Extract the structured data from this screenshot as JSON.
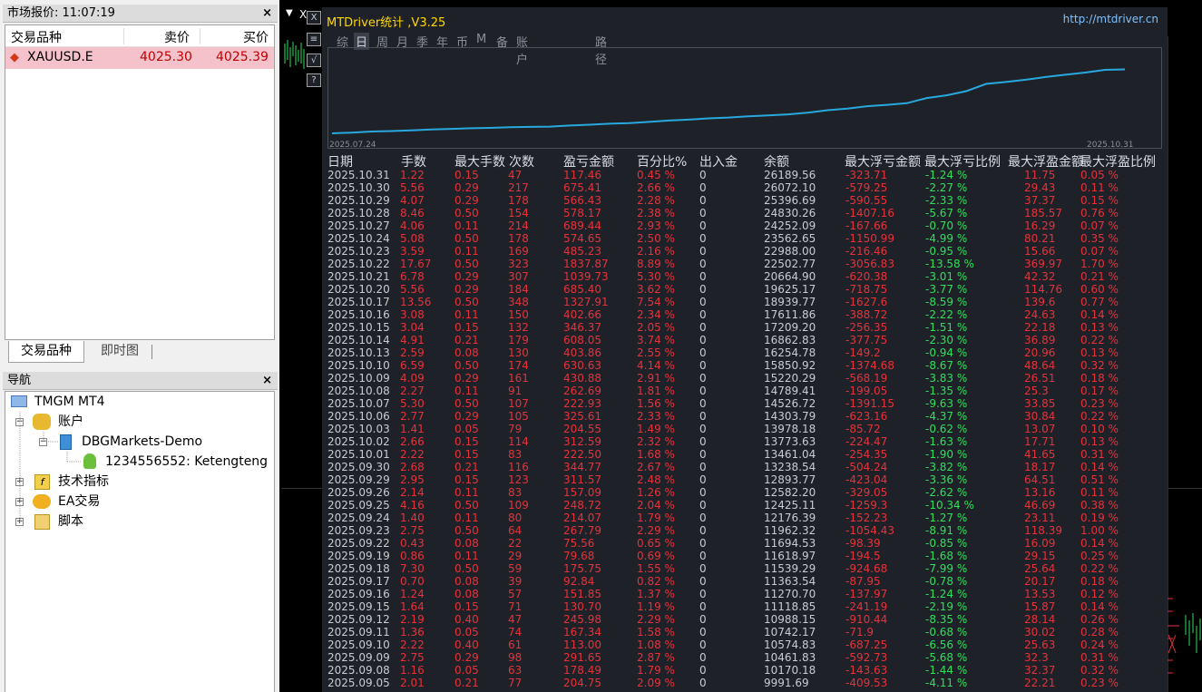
{
  "market_watch": {
    "title": "市场报价: 11:07:19",
    "columns": [
      "交易品种",
      "卖价",
      "买价"
    ],
    "row": {
      "symbol": "XAUUSD.E",
      "bid": "4025.30",
      "ask": "4025.39"
    },
    "tabs": [
      "交易品种",
      "即时图"
    ]
  },
  "navigator": {
    "title": "导航",
    "root": "TMGM MT4",
    "accounts": "账户",
    "server": "DBGMarkets-Demo",
    "account": "1234556552: Ketengteng",
    "indicators": "技术指标",
    "ea": "EA交易",
    "scripts": "脚本"
  },
  "chart_window": {
    "close_label": "X"
  },
  "overlay": {
    "title": "MTDriver统计 ,V3.25",
    "link": "http://mtdriver.cn",
    "tabs": [
      "综",
      "日",
      "周",
      "月",
      "季",
      "年",
      "币",
      "M",
      "备",
      "账户",
      "路径"
    ],
    "selected_tab": "日",
    "buttons": [
      "X",
      "≡",
      "√",
      "?"
    ],
    "headers": [
      "日期",
      "手数",
      "最大手数",
      "次数",
      "盈亏金额",
      "百分比%",
      "出入金",
      "余额",
      "最大浮亏金额",
      "最大浮亏比例",
      "最大浮盈金额",
      "最大浮盈比例"
    ]
  },
  "chart_data": {
    "type": "line",
    "x_start": "2025.07.24",
    "x_end": "2025.10.31",
    "line_color": "#29a8e0",
    "balance_series": [
      9991.69,
      10170.18,
      10461.83,
      10574.83,
      10742.17,
      10988.15,
      11118.85,
      11270.7,
      11363.54,
      11539.29,
      11618.97,
      11694.53,
      11962.32,
      12176.39,
      12425.11,
      12582.2,
      12893.77,
      13238.54,
      13461.04,
      13773.63,
      13978.18,
      14303.79,
      14526.72,
      14789.41,
      15220.29,
      15850.92,
      16254.78,
      16862.83,
      17209.2,
      17611.86,
      18939.77,
      19625.17,
      20664.9,
      22502.77,
      22988.0,
      23562.65,
      24252.09,
      24830.26,
      25396.69,
      26072.1,
      26189.56
    ],
    "rows": [
      [
        "2025.10.31",
        "1.22",
        "0.15",
        "47",
        "117.46",
        "0.45 %",
        "0",
        "26189.56",
        "-323.71",
        "-1.24 %",
        "11.75",
        "0.05 %"
      ],
      [
        "2025.10.30",
        "5.56",
        "0.29",
        "217",
        "675.41",
        "2.66 %",
        "0",
        "26072.10",
        "-579.25",
        "-2.27 %",
        "29.43",
        "0.11 %"
      ],
      [
        "2025.10.29",
        "4.07",
        "0.29",
        "178",
        "566.43",
        "2.28 %",
        "0",
        "25396.69",
        "-590.55",
        "-2.33 %",
        "37.37",
        "0.15 %"
      ],
      [
        "2025.10.28",
        "8.46",
        "0.50",
        "154",
        "578.17",
        "2.38 %",
        "0",
        "24830.26",
        "-1407.16",
        "-5.67 %",
        "185.57",
        "0.76 %"
      ],
      [
        "2025.10.27",
        "4.06",
        "0.11",
        "214",
        "689.44",
        "2.93 %",
        "0",
        "24252.09",
        "-167.66",
        "-0.70 %",
        "16.29",
        "0.07 %"
      ],
      [
        "2025.10.24",
        "5.08",
        "0.50",
        "178",
        "574.65",
        "2.50 %",
        "0",
        "23562.65",
        "-1150.99",
        "-4.99 %",
        "80.21",
        "0.35 %"
      ],
      [
        "2025.10.23",
        "3.59",
        "0.11",
        "169",
        "485.23",
        "2.16 %",
        "0",
        "22988.00",
        "-216.46",
        "-0.95 %",
        "15.66",
        "0.07 %"
      ],
      [
        "2025.10.22",
        "17.67",
        "0.50",
        "323",
        "1837.87",
        "8.89 %",
        "0",
        "22502.77",
        "-3056.83",
        "-13.58 %",
        "369.97",
        "1.70 %"
      ],
      [
        "2025.10.21",
        "6.78",
        "0.29",
        "307",
        "1039.73",
        "5.30 %",
        "0",
        "20664.90",
        "-620.38",
        "-3.01 %",
        "42.32",
        "0.21 %"
      ],
      [
        "2025.10.20",
        "5.56",
        "0.29",
        "184",
        "685.40",
        "3.62 %",
        "0",
        "19625.17",
        "-718.75",
        "-3.77 %",
        "114.76",
        "0.60 %"
      ],
      [
        "2025.10.17",
        "13.56",
        "0.50",
        "348",
        "1327.91",
        "7.54 %",
        "0",
        "18939.77",
        "-1627.6",
        "-8.59 %",
        "139.6",
        "0.77 %"
      ],
      [
        "2025.10.16",
        "3.08",
        "0.11",
        "150",
        "402.66",
        "2.34 %",
        "0",
        "17611.86",
        "-388.72",
        "-2.22 %",
        "24.63",
        "0.14 %"
      ],
      [
        "2025.10.15",
        "3.04",
        "0.15",
        "132",
        "346.37",
        "2.05 %",
        "0",
        "17209.20",
        "-256.35",
        "-1.51 %",
        "22.18",
        "0.13 %"
      ],
      [
        "2025.10.14",
        "4.91",
        "0.21",
        "179",
        "608.05",
        "3.74 %",
        "0",
        "16862.83",
        "-377.75",
        "-2.30 %",
        "36.89",
        "0.22 %"
      ],
      [
        "2025.10.13",
        "2.59",
        "0.08",
        "130",
        "403.86",
        "2.55 %",
        "0",
        "16254.78",
        "-149.2",
        "-0.94 %",
        "20.96",
        "0.13 %"
      ],
      [
        "2025.10.10",
        "6.59",
        "0.50",
        "174",
        "630.63",
        "4.14 %",
        "0",
        "15850.92",
        "-1374.68",
        "-8.67 %",
        "48.64",
        "0.32 %"
      ],
      [
        "2025.10.09",
        "4.09",
        "0.29",
        "161",
        "430.88",
        "2.91 %",
        "0",
        "15220.29",
        "-568.19",
        "-3.83 %",
        "26.51",
        "0.18 %"
      ],
      [
        "2025.10.08",
        "2.27",
        "0.11",
        "91",
        "262.69",
        "1.81 %",
        "0",
        "14789.41",
        "-199.05",
        "-1.35 %",
        "25.3",
        "0.17 %"
      ],
      [
        "2025.10.07",
        "5.30",
        "0.50",
        "107",
        "222.93",
        "1.56 %",
        "0",
        "14526.72",
        "-1391.15",
        "-9.63 %",
        "33.85",
        "0.23 %"
      ],
      [
        "2025.10.06",
        "2.77",
        "0.29",
        "105",
        "325.61",
        "2.33 %",
        "0",
        "14303.79",
        "-623.16",
        "-4.37 %",
        "30.84",
        "0.22 %"
      ],
      [
        "2025.10.03",
        "1.41",
        "0.05",
        "79",
        "204.55",
        "1.49 %",
        "0",
        "13978.18",
        "-85.72",
        "-0.62 %",
        "13.07",
        "0.10 %"
      ],
      [
        "2025.10.02",
        "2.66",
        "0.15",
        "114",
        "312.59",
        "2.32 %",
        "0",
        "13773.63",
        "-224.47",
        "-1.63 %",
        "17.71",
        "0.13 %"
      ],
      [
        "2025.10.01",
        "2.22",
        "0.15",
        "83",
        "222.50",
        "1.68 %",
        "0",
        "13461.04",
        "-254.35",
        "-1.90 %",
        "41.65",
        "0.31 %"
      ],
      [
        "2025.09.30",
        "2.68",
        "0.21",
        "116",
        "344.77",
        "2.67 %",
        "0",
        "13238.54",
        "-504.24",
        "-3.82 %",
        "18.17",
        "0.14 %"
      ],
      [
        "2025.09.29",
        "2.95",
        "0.15",
        "123",
        "311.57",
        "2.48 %",
        "0",
        "12893.77",
        "-423.04",
        "-3.36 %",
        "64.51",
        "0.51 %"
      ],
      [
        "2025.09.26",
        "2.14",
        "0.11",
        "83",
        "157.09",
        "1.26 %",
        "0",
        "12582.20",
        "-329.05",
        "-2.62 %",
        "13.16",
        "0.11 %"
      ],
      [
        "2025.09.25",
        "4.16",
        "0.50",
        "109",
        "248.72",
        "2.04 %",
        "0",
        "12425.11",
        "-1259.3",
        "-10.34 %",
        "46.69",
        "0.38 %"
      ],
      [
        "2025.09.24",
        "1.40",
        "0.11",
        "80",
        "214.07",
        "1.79 %",
        "0",
        "12176.39",
        "-152.23",
        "-1.27 %",
        "23.11",
        "0.19 %"
      ],
      [
        "2025.09.23",
        "2.75",
        "0.50",
        "64",
        "267.79",
        "2.29 %",
        "0",
        "11962.32",
        "-1054.43",
        "-8.91 %",
        "118.39",
        "1.00 %"
      ],
      [
        "2025.09.22",
        "0.43",
        "0.08",
        "22",
        "75.56",
        "0.65 %",
        "0",
        "11694.53",
        "-98.39",
        "-0.85 %",
        "16.09",
        "0.14 %"
      ],
      [
        "2025.09.19",
        "0.86",
        "0.11",
        "29",
        "79.68",
        "0.69 %",
        "0",
        "11618.97",
        "-194.5",
        "-1.68 %",
        "29.15",
        "0.25 %"
      ],
      [
        "2025.09.18",
        "7.30",
        "0.50",
        "59",
        "175.75",
        "1.55 %",
        "0",
        "11539.29",
        "-924.68",
        "-7.99 %",
        "25.64",
        "0.22 %"
      ],
      [
        "2025.09.17",
        "0.70",
        "0.08",
        "39",
        "92.84",
        "0.82 %",
        "0",
        "11363.54",
        "-87.95",
        "-0.78 %",
        "20.17",
        "0.18 %"
      ],
      [
        "2025.09.16",
        "1.24",
        "0.08",
        "57",
        "151.85",
        "1.37 %",
        "0",
        "11270.70",
        "-137.97",
        "-1.24 %",
        "13.53",
        "0.12 %"
      ],
      [
        "2025.09.15",
        "1.64",
        "0.15",
        "71",
        "130.70",
        "1.19 %",
        "0",
        "11118.85",
        "-241.19",
        "-2.19 %",
        "15.87",
        "0.14 %"
      ],
      [
        "2025.09.12",
        "2.19",
        "0.40",
        "47",
        "245.98",
        "2.29 %",
        "0",
        "10988.15",
        "-910.44",
        "-8.35 %",
        "28.14",
        "0.26 %"
      ],
      [
        "2025.09.11",
        "1.36",
        "0.05",
        "74",
        "167.34",
        "1.58 %",
        "0",
        "10742.17",
        "-71.9",
        "-0.68 %",
        "30.02",
        "0.28 %"
      ],
      [
        "2025.09.10",
        "2.22",
        "0.40",
        "61",
        "113.00",
        "1.08 %",
        "0",
        "10574.83",
        "-687.25",
        "-6.56 %",
        "25.63",
        "0.24 %"
      ],
      [
        "2025.09.09",
        "2.75",
        "0.29",
        "98",
        "291.65",
        "2.87 %",
        "0",
        "10461.83",
        "-592.73",
        "-5.68 %",
        "32.3",
        "0.31 %"
      ],
      [
        "2025.09.08",
        "1.16",
        "0.05",
        "63",
        "178.49",
        "1.79 %",
        "0",
        "10170.18",
        "-143.63",
        "-1.44 %",
        "32.37",
        "0.32 %"
      ],
      [
        "2025.09.05",
        "2.01",
        "0.21",
        "77",
        "204.75",
        "2.09 %",
        "0",
        "9991.69",
        "-409.53",
        "-4.11 %",
        "22.21",
        "0.23 %"
      ]
    ]
  }
}
